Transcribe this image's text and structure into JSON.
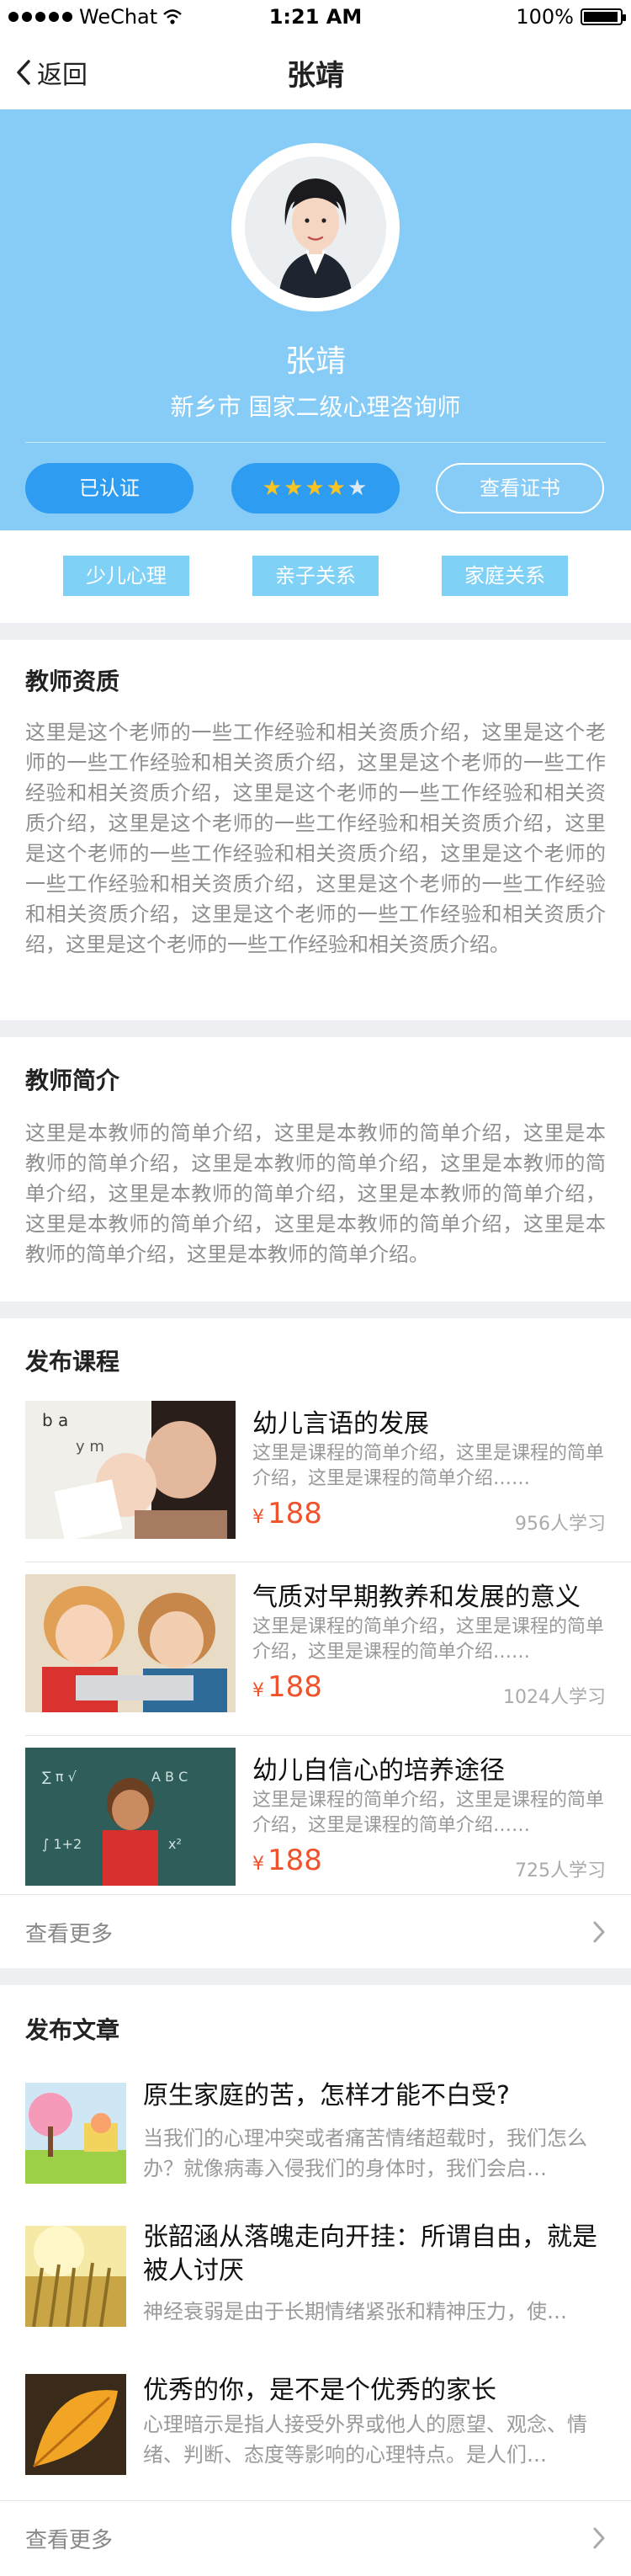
{
  "status_bar": {
    "carrier": "WeChat",
    "time": "1:21 AM",
    "battery": "100%"
  },
  "nav": {
    "back_label": "返回",
    "title": "张靖"
  },
  "profile": {
    "name": "张靖",
    "subtitle": "新乡市   国家二级心理咨询师",
    "verified_label": "已认证",
    "rating": {
      "filled": "★★★★",
      "empty": "★",
      "value": 4,
      "max": 5
    },
    "cert_button": "查看证书"
  },
  "tags": [
    "少儿心理",
    "亲子关系",
    "家庭关系"
  ],
  "qualification": {
    "title": "教师资质",
    "text": "这里是这个老师的一些工作经验和相关资质介绍，这里是这个老师的一些工作经验和相关资质介绍，这里是这个老师的一些工作经验和相关资质介绍，这里是这个老师的一些工作经验和相关资质介绍，这里是这个老师的一些工作经验和相关资质介绍，这里是这个老师的一些工作经验和相关资质介绍，这里是这个老师的一些工作经验和相关资质介绍，这里是这个老师的一些工作经验和相关资质介绍，这里是这个老师的一些工作经验和相关资质介绍，这里是这个老师的一些工作经验和相关资质介绍。"
  },
  "intro": {
    "title": "教师简介",
    "text": "这里是本教师的简单介绍，这里是本教师的简单介绍，这里是本教师的简单介绍，这里是本教师的简单介绍，这里是本教师的简单介绍，这里是本教师的简单介绍，这里是本教师的简单介绍，这里是本教师的简单介绍，这里是本教师的简单介绍，这里是本教师的简单介绍，这里是本教师的简单介绍。"
  },
  "courses": {
    "title": "发布课程",
    "items": [
      {
        "title": "幼儿言语的发展",
        "desc": "这里是课程的简单介绍，这里是课程的简单介绍，这里是课程的简单介绍……",
        "currency": "¥",
        "price": "188",
        "learners": "956人学习"
      },
      {
        "title": "气质对早期教养和发展的意义",
        "desc": "这里是课程的简单介绍，这里是课程的简单介绍，这里是课程的简单介绍……",
        "currency": "¥",
        "price": "188",
        "learners": "1024人学习"
      },
      {
        "title": "幼儿自信心的培养途径",
        "desc": "这里是课程的简单介绍，这里是课程的简单介绍，这里是课程的简单介绍……",
        "currency": "¥",
        "price": "188",
        "learners": "725人学习"
      }
    ],
    "more_label": "查看更多"
  },
  "articles": {
    "title": "发布文章",
    "items": [
      {
        "title": "原生家庭的苦，怎样才能不白受?",
        "desc": "当我们的心理冲突或者痛苦情绪超载时，我们怎么办？就像病毒入侵我们的身体时，我们会启…"
      },
      {
        "title": "张韶涵从落魄走向开挂：所谓自由，就是被人讨厌",
        "desc": "神经衰弱是由于长期情绪紧张和精神压力，使…"
      },
      {
        "title": "优秀的你，是不是个优秀的家长",
        "desc": "心理暗示是指人接受外界或他人的愿望、观念、情绪、判断、态度等影响的心理特点。是人们…"
      }
    ],
    "more_label": "查看更多"
  },
  "colors": {
    "hero": "#86ccf6",
    "accent": "#2e9cf0",
    "price": "#f0522c",
    "tag": "#7fd1f6"
  }
}
